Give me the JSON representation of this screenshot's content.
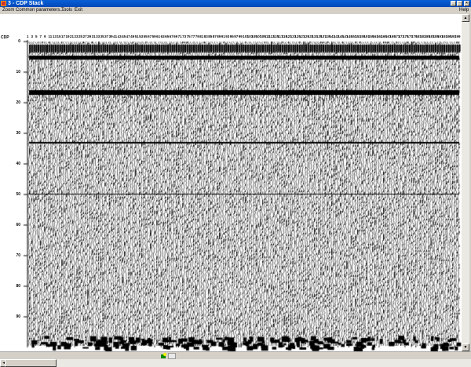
{
  "window": {
    "title": "3 - CDP Stack",
    "minimize": "_",
    "maximize": "▫",
    "close": "×"
  },
  "menu": {
    "zoom": "Zoom",
    "common": "Common parameters...",
    "tools": "Tools",
    "exit": "Exit",
    "help": "Help"
  },
  "axis": {
    "x_title": "CDP",
    "y_ticks": [
      "0",
      "10",
      "20",
      "30",
      "40",
      "50",
      "60",
      "70",
      "80",
      "90"
    ],
    "x_first": 1,
    "x_last": 199,
    "x_step": 2
  },
  "scroll": {
    "up": "▲",
    "down": "▼",
    "left": "◄"
  }
}
